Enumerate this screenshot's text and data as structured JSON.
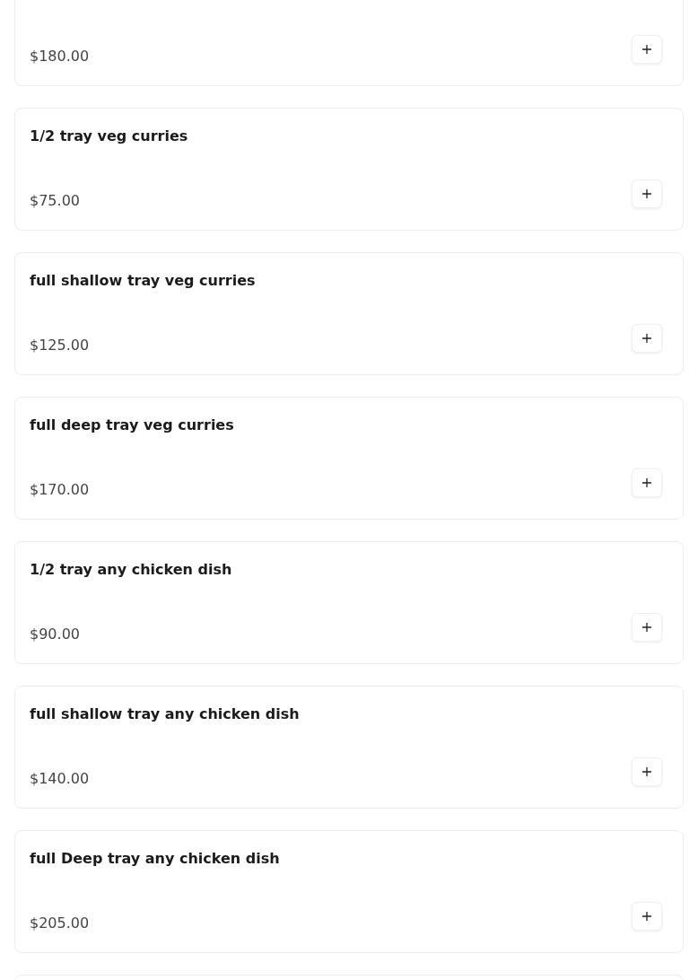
{
  "items": [
    {
      "price": "$180.00"
    },
    {
      "title": "1/2 tray veg curries",
      "price": "$75.00"
    },
    {
      "title": "full shallow tray veg curries",
      "price": "$125.00"
    },
    {
      "title": "full deep tray veg curries",
      "price": "$170.00"
    },
    {
      "title": "1/2 tray any chicken dish",
      "price": "$90.00"
    },
    {
      "title": "full shallow tray any chicken dish",
      "price": "$140.00"
    },
    {
      "title": "full Deep tray any chicken dish",
      "price": "$205.00"
    }
  ]
}
